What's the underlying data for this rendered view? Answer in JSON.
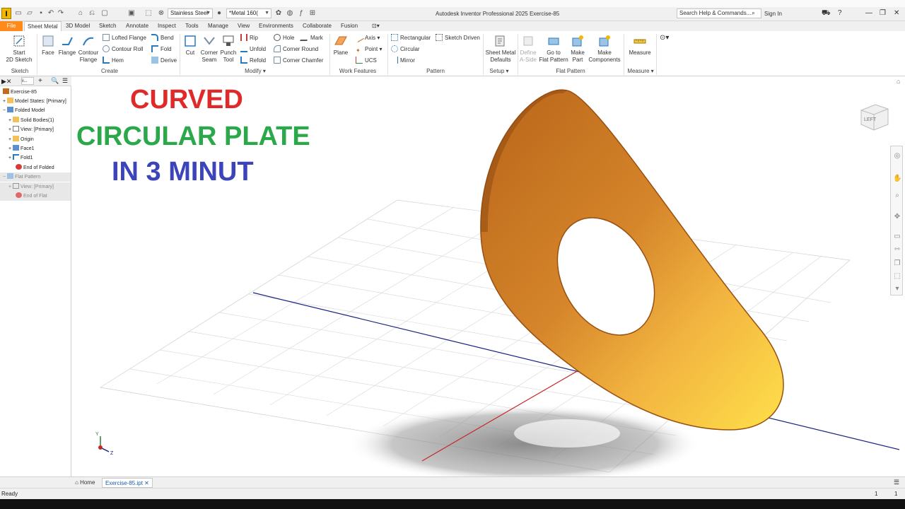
{
  "titlebar": {
    "material": "Stainless Steel",
    "appearance": "*Metal 160(",
    "app_title": "Autodesk Inventor Professional 2025   Exercise-85",
    "search_placeholder": "Search Help & Commands...",
    "sign_in": "Sign In"
  },
  "tabs": [
    {
      "label": "File"
    },
    {
      "label": "Sheet Metal"
    },
    {
      "label": "3D Model"
    },
    {
      "label": "Sketch"
    },
    {
      "label": "Annotate"
    },
    {
      "label": "Inspect"
    },
    {
      "label": "Tools"
    },
    {
      "label": "Manage"
    },
    {
      "label": "View"
    },
    {
      "label": "Environments"
    },
    {
      "label": "Collaborate"
    },
    {
      "label": "Fusion"
    }
  ],
  "ribbon": {
    "sketch": {
      "start_line1": "Start",
      "start_line2": "2D Sketch",
      "group": "Sketch"
    },
    "create": {
      "face": "Face",
      "flange": "Flange",
      "contour_flange_1": "Contour",
      "contour_flange_2": "Flange",
      "lofted_flange": "Lofted Flange",
      "contour_roll": "Contour Roll",
      "hem": "Hem",
      "bend": "Bend",
      "fold": "Fold",
      "derive": "Derive",
      "group": "Create"
    },
    "modify": {
      "cut": "Cut",
      "corner_seam_1": "Corner",
      "corner_seam_2": "Seam",
      "punch_1": "Punch",
      "punch_2": "Tool",
      "rip": "Rip",
      "unfold": "Unfold",
      "refold": "Refold",
      "hole": "Hole",
      "mark": "Mark",
      "corner_round": "Corner Round",
      "corner_chamfer": "Corner Chamfer",
      "group": "Modify"
    },
    "work": {
      "plane": "Plane",
      "axis": "Axis",
      "point": "Point",
      "ucs": "UCS",
      "group": "Work Features"
    },
    "pattern": {
      "rectangular": "Rectangular",
      "circular": "Circular",
      "mirror": "Mirror",
      "sketch_driven": "Sketch Driven",
      "group": "Pattern"
    },
    "setup": {
      "defaults_1": "Sheet Metal",
      "defaults_2": "Defaults",
      "group": "Setup"
    },
    "flat": {
      "define_1": "Define",
      "define_2": "A-Side",
      "goto_1": "Go to",
      "goto_2": "Flat Pattern",
      "make_part_1": "Make",
      "make_part_2": "Part",
      "make_comp_1": "Make",
      "make_comp_2": "Components",
      "group": "Flat Pattern"
    },
    "measure": {
      "measure": "Measure",
      "group": "Measure"
    }
  },
  "browser": {
    "search_label": "🔍",
    "items": [
      {
        "label": "Exercise-85"
      },
      {
        "label": "Model States: [Primary]"
      },
      {
        "label": "Folded Model"
      },
      {
        "label": "Solid Bodies(1)"
      },
      {
        "label": "View: [Primary]"
      },
      {
        "label": "Origin"
      },
      {
        "label": "Face1"
      },
      {
        "label": "Fold1"
      },
      {
        "label": "End of Folded"
      },
      {
        "label": "Flat Pattern"
      },
      {
        "label": "View: [Primary]"
      },
      {
        "label": "End of Flat"
      }
    ]
  },
  "viewport": {
    "line1": "CURVED",
    "line2": "CIRCULAR  PLATE",
    "line3": "IN 3 MINUT",
    "line1_color": "#e02a2a",
    "line2_color": "#2aa84a",
    "line3_color": "#3b44b8",
    "viewcube_label": "LEFT",
    "axis_y": "Y",
    "axis_z": "Z"
  },
  "doctabs": {
    "home": "Home",
    "file": "Exercise-85.ipt"
  },
  "status": {
    "text": "Ready",
    "count1": "1",
    "count2": "1"
  },
  "colors": {
    "accent": "#ff8a1a",
    "plate_light": "#f5c84a",
    "plate_dark": "#c46a1c"
  }
}
